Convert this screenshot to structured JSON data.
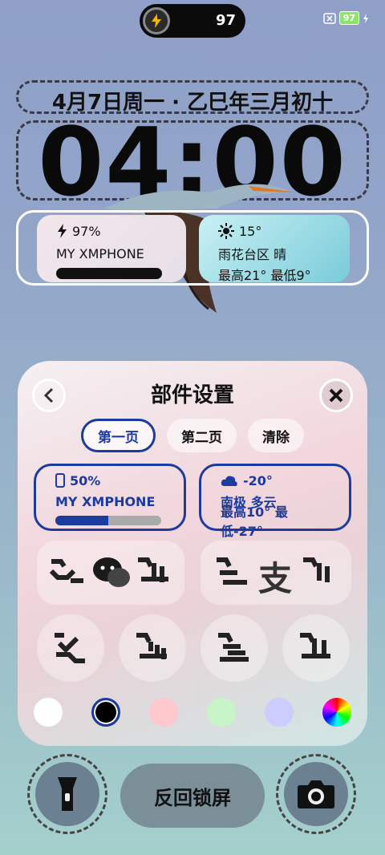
{
  "status": {
    "pill_value": "97",
    "battery": "97"
  },
  "lock": {
    "date": "4月7日周一 · 乙巳年三月初十",
    "time": "04:00"
  },
  "widgets": {
    "device": {
      "percent": "97%",
      "name": "MY XMPHONE"
    },
    "weather": {
      "temp": "15°",
      "location": "雨花台区 晴",
      "range": "最高21° 最低9°"
    }
  },
  "panel": {
    "title": "部件设置",
    "tabs": [
      "第一页",
      "第二页",
      "清除"
    ],
    "device": {
      "percent": "50%",
      "name": "MY XMPHONE",
      "progress": 0.5
    },
    "weather": {
      "temp": "-20°",
      "location": "南极 多云",
      "range": "最高10° 最低-27°"
    },
    "app_chars": {
      "alipay": "支"
    },
    "swatches": [
      "#ffffff",
      "#000000",
      "#ffc8cc",
      "#c8f5c8",
      "#ccccff",
      "rainbow"
    ]
  },
  "bottom": {
    "back_label": "反回锁屏"
  }
}
